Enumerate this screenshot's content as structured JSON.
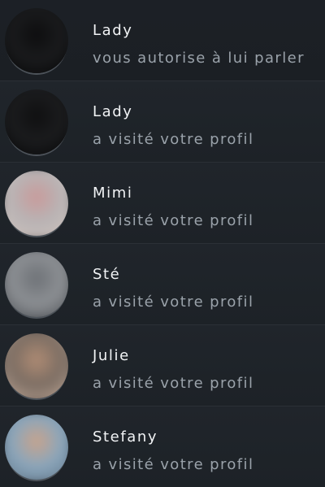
{
  "notifications": [
    {
      "name": "Lady",
      "message": "vous autorise à lui parler",
      "avatar_icon": "avatar-photo-icon",
      "avatar_colors": [
        "#1a1b1d",
        "#0d0d0e",
        "#000000"
      ]
    },
    {
      "name": "Lady",
      "message": "a visité votre profil",
      "avatar_icon": "avatar-photo-icon",
      "avatar_colors": [
        "#1b1c1e",
        "#0f0f10",
        "#000000"
      ]
    },
    {
      "name": "Mimi",
      "message": "a visité votre profil",
      "avatar_icon": "avatar-photo-icon",
      "avatar_colors": [
        "#b8b4b5",
        "#c99a9a",
        "#d7c5bd"
      ]
    },
    {
      "name": "Sté",
      "message": "a visité votre profil",
      "avatar_icon": "avatar-photo-icon",
      "avatar_colors": [
        "#8d9094",
        "#6d7176",
        "#3b3f44"
      ]
    },
    {
      "name": "Julie",
      "message": "a visité votre profil",
      "avatar_icon": "avatar-photo-icon",
      "avatar_colors": [
        "#7b6d63",
        "#b08c74",
        "#d2b6a3"
      ]
    },
    {
      "name": "Stefany",
      "message": "a visité votre profil",
      "avatar_icon": "avatar-photo-icon",
      "avatar_colors": [
        "#8aa6bc",
        "#c9a38b",
        "#5d6e7e"
      ]
    }
  ]
}
